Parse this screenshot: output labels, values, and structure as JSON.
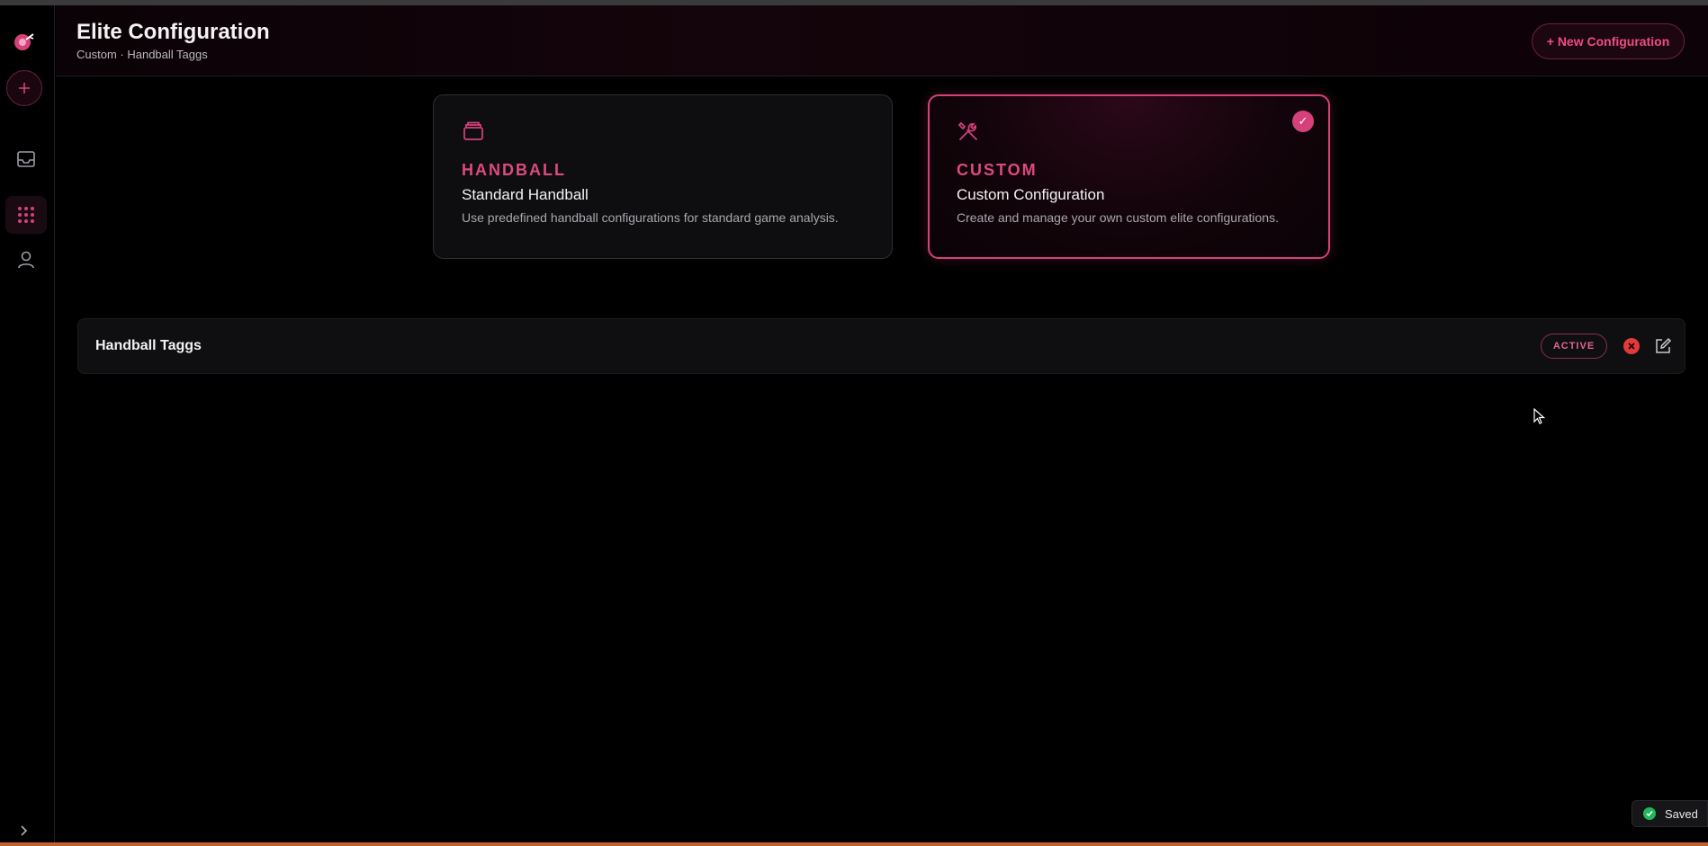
{
  "header": {
    "title": "Elite Configuration",
    "breadcrumb": "Custom · Handball Taggs",
    "new_button_label": "+ New Configuration"
  },
  "sidebar": {
    "items": [
      {
        "name": "logo-icon"
      },
      {
        "name": "add-icon"
      },
      {
        "name": "inbox-icon"
      },
      {
        "name": "grid-icon",
        "active": true
      },
      {
        "name": "user-icon"
      }
    ]
  },
  "cards": [
    {
      "tag": "HANDBALL",
      "name": "Standard Handball",
      "description": "Use predefined handball configurations for standard game analysis.",
      "icon": "archive-icon",
      "selected": false
    },
    {
      "tag": "CUSTOM",
      "name": "Custom Configuration",
      "description": "Create and manage your own custom elite configurations.",
      "icon": "tools-icon",
      "selected": true,
      "check": "✓"
    }
  ],
  "configurations": [
    {
      "name": "Handball Taggs",
      "status": "ACTIVE"
    }
  ],
  "toast": {
    "label": "Saved"
  },
  "colors": {
    "accent": "#d6417a",
    "success": "#22b75a",
    "danger": "#e03a3a"
  }
}
